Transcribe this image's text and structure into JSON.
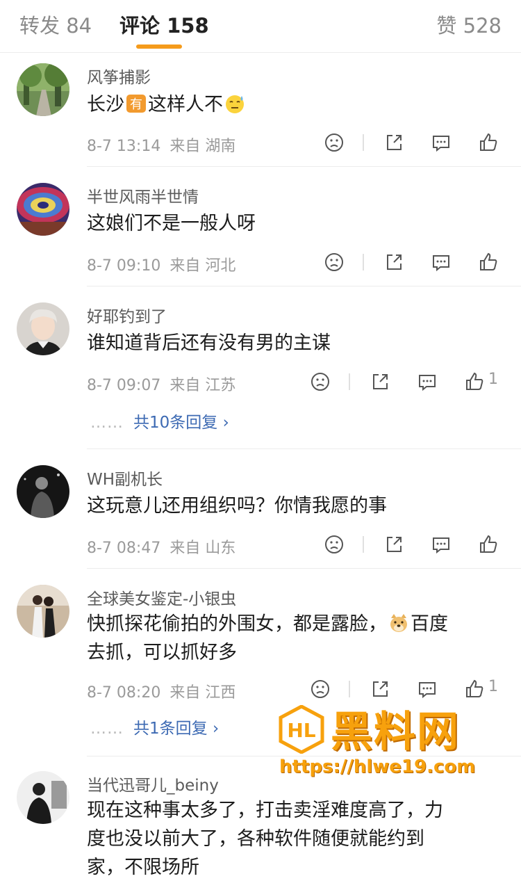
{
  "tabs": {
    "forward_label": "转发 84",
    "comment_label": "评论 158",
    "like_label": "赞 528",
    "accent": "#f59b1b"
  },
  "comments": [
    {
      "username": "风筝捕影",
      "text_before": "长沙",
      "inline_badge": "有",
      "text_after": "这样人不",
      "trailing_emoji": "sweat-smile-emoji",
      "time": "8-7 13:14",
      "source": "来自 湖南",
      "like_count": ""
    },
    {
      "username": "半世风雨半世情",
      "text": "这娘们不是一般人呀",
      "time": "8-7 09:10",
      "source": "来自 河北",
      "like_count": ""
    },
    {
      "username": "好耶钓到了",
      "text": "谁知道背后还有没有男的主谋",
      "time": "8-7 09:07",
      "source": "来自 江苏",
      "like_count": "1",
      "reply_dots": "……",
      "reply_label": "共10条回复 ›"
    },
    {
      "username": "WH副机长",
      "text": "这玩意儿还用组织吗？你情我愿的事",
      "time": "8-7 08:47",
      "source": "来自 山东",
      "like_count": ""
    },
    {
      "username": "全球美女鉴定-小银虫",
      "text_line1_before": "快抓探花偷拍的外围女，都是露脸，",
      "inline_emoji": "doge-emoji",
      "text_line1_after": "百度",
      "text_line2": "去抓，可以抓好多",
      "time": "8-7 08:20",
      "source": "来自 江西",
      "like_count": "1",
      "reply_dots": "……",
      "reply_label": "共1条回复 ›"
    },
    {
      "username": "当代迅哥儿_beiny",
      "text_line1": "现在这种事太多了，打击卖淫难度高了，力",
      "text_line2": "度也没以前大了，各种软件随便就能约到",
      "text_line3": "家，不限场所"
    }
  ],
  "watermark": {
    "title": "黑料网",
    "url": "https://hlwe19.com",
    "logo_text": "HL",
    "color": "#f7a10d"
  }
}
